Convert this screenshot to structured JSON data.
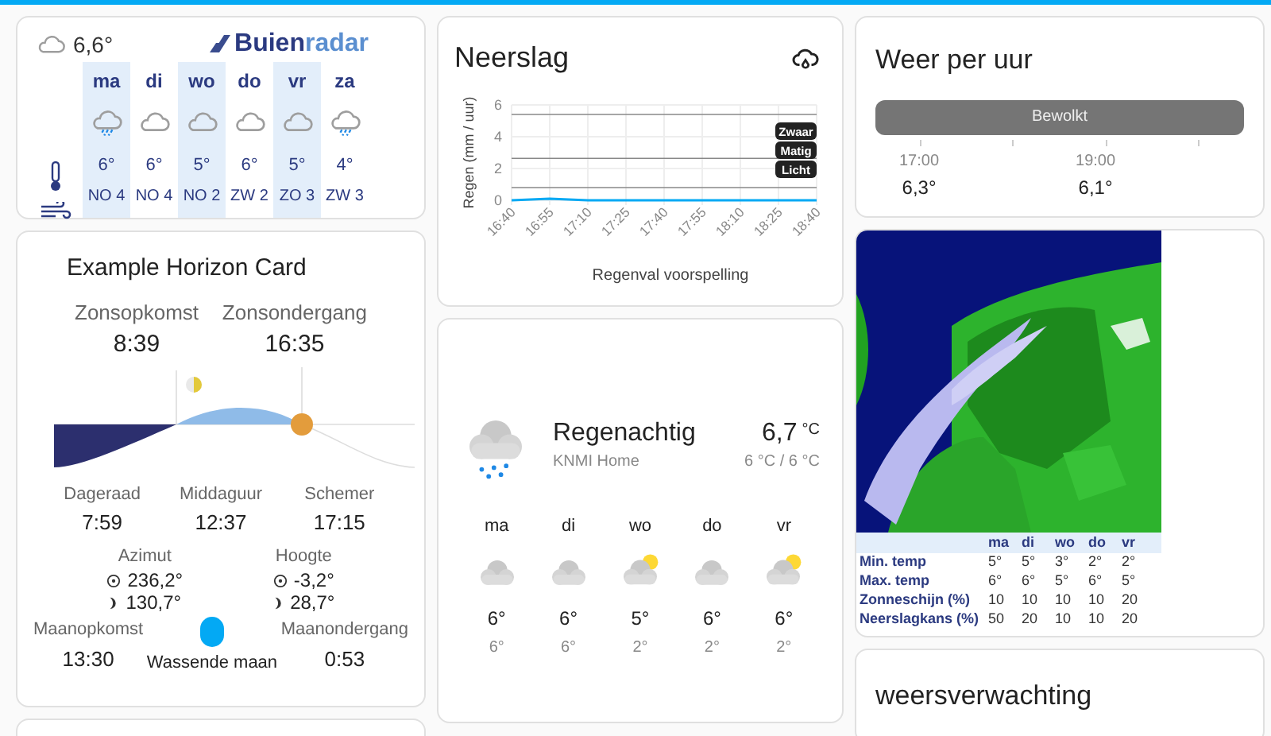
{
  "buienradar_widget": {
    "current_temp": "6,6°",
    "logo": [
      "Buien",
      "radar"
    ],
    "days": [
      {
        "day": "ma",
        "kind": "rain",
        "temp": "6°",
        "wind": "NO 4",
        "shaded": true
      },
      {
        "day": "di",
        "kind": "cloudy",
        "temp": "6°",
        "wind": "NO 4",
        "shaded": false
      },
      {
        "day": "wo",
        "kind": "cloudy",
        "temp": "5°",
        "wind": "NO 2",
        "shaded": true
      },
      {
        "day": "do",
        "kind": "cloudy",
        "temp": "6°",
        "wind": "ZW 2",
        "shaded": false
      },
      {
        "day": "vr",
        "kind": "cloudy",
        "temp": "5°",
        "wind": "ZO 3",
        "shaded": true
      },
      {
        "day": "za",
        "kind": "rain",
        "temp": "4°",
        "wind": "ZW 3",
        "shaded": false
      }
    ]
  },
  "horizon_card": {
    "title": "Example Horizon Card",
    "sun_times": [
      {
        "label": "Zonsopkomst",
        "value": "8:39"
      },
      {
        "label": "Zonsondergang",
        "value": "16:35"
      }
    ],
    "day_times": [
      {
        "label": "Dageraad",
        "value": "7:59"
      },
      {
        "label": "Middaguur",
        "value": "12:37"
      },
      {
        "label": "Schemer",
        "value": "17:15"
      }
    ],
    "angles": [
      {
        "label": "Azimut",
        "sun": "236,2°",
        "moon": "130,7°"
      },
      {
        "label": "Hoogte",
        "sun": "-3,2°",
        "moon": "28,7°"
      }
    ],
    "moonrise": {
      "label": "Maanopkomst",
      "value": "13:30"
    },
    "moon_phase": "Wassende maan",
    "moonset": {
      "label": "Maanondergang",
      "value": "0:53"
    }
  },
  "neerslag": {
    "title": "Neerslag",
    "chart_data": {
      "type": "line",
      "xlabel": "Regenval voorspelling",
      "ylabel": "Regen (mm / uur)",
      "categories": [
        "16:40",
        "16:55",
        "17:10",
        "17:25",
        "17:40",
        "17:55",
        "18:10",
        "18:25",
        "18:40"
      ],
      "series": [
        {
          "color": "#03a9f4",
          "values": [
            0,
            0.1,
            0,
            0,
            0,
            0,
            0,
            0,
            0
          ]
        }
      ],
      "ylim": [
        0,
        6
      ],
      "yticks": [
        0,
        2,
        4,
        6
      ],
      "grid": true,
      "annotations": [
        {
          "text": "Zwaar"
        },
        {
          "text": "Matig"
        },
        {
          "text": "Licht"
        }
      ]
    }
  },
  "weather_card": {
    "condition": "Regenachtig",
    "source": "KNMI Home",
    "temperature": "6,7",
    "unit": "°C",
    "range": "6 °C / 6 °C",
    "forecast": [
      {
        "day": "ma",
        "kind": "cloudy",
        "high": "6°",
        "low": "6°"
      },
      {
        "day": "di",
        "kind": "cloudy",
        "high": "6°",
        "low": "6°"
      },
      {
        "day": "wo",
        "kind": "partly_sunny",
        "high": "5°",
        "low": "2°"
      },
      {
        "day": "do",
        "kind": "cloudy",
        "high": "6°",
        "low": "2°"
      },
      {
        "day": "vr",
        "kind": "partly_sunny",
        "high": "6°",
        "low": "2°"
      }
    ]
  },
  "weer_per_uur": {
    "title": "Weer per uur",
    "condition": "Bewolkt",
    "hours": [
      {
        "time": "17:00",
        "temp": "6,3°"
      },
      {
        "time": "19:00",
        "temp": "6,1°"
      }
    ]
  },
  "radar": {
    "kind": "picture",
    "table": {
      "columns": [
        "ma",
        "di",
        "wo",
        "do",
        "vr"
      ],
      "rows": [
        {
          "label": "Min. temp",
          "values": [
            "5°",
            "5°",
            "3°",
            "2°",
            "2°"
          ]
        },
        {
          "label": "Max. temp",
          "values": [
            "6°",
            "6°",
            "5°",
            "6°",
            "5°"
          ]
        },
        {
          "label": "Zonneschijn (%)",
          "values": [
            "10",
            "10",
            "10",
            "10",
            "20"
          ]
        },
        {
          "label": "Neerslagkans (%)",
          "values": [
            "50",
            "20",
            "10",
            "10",
            "20"
          ]
        }
      ]
    }
  },
  "weersverwachting": {
    "title": "weersverwachting"
  }
}
